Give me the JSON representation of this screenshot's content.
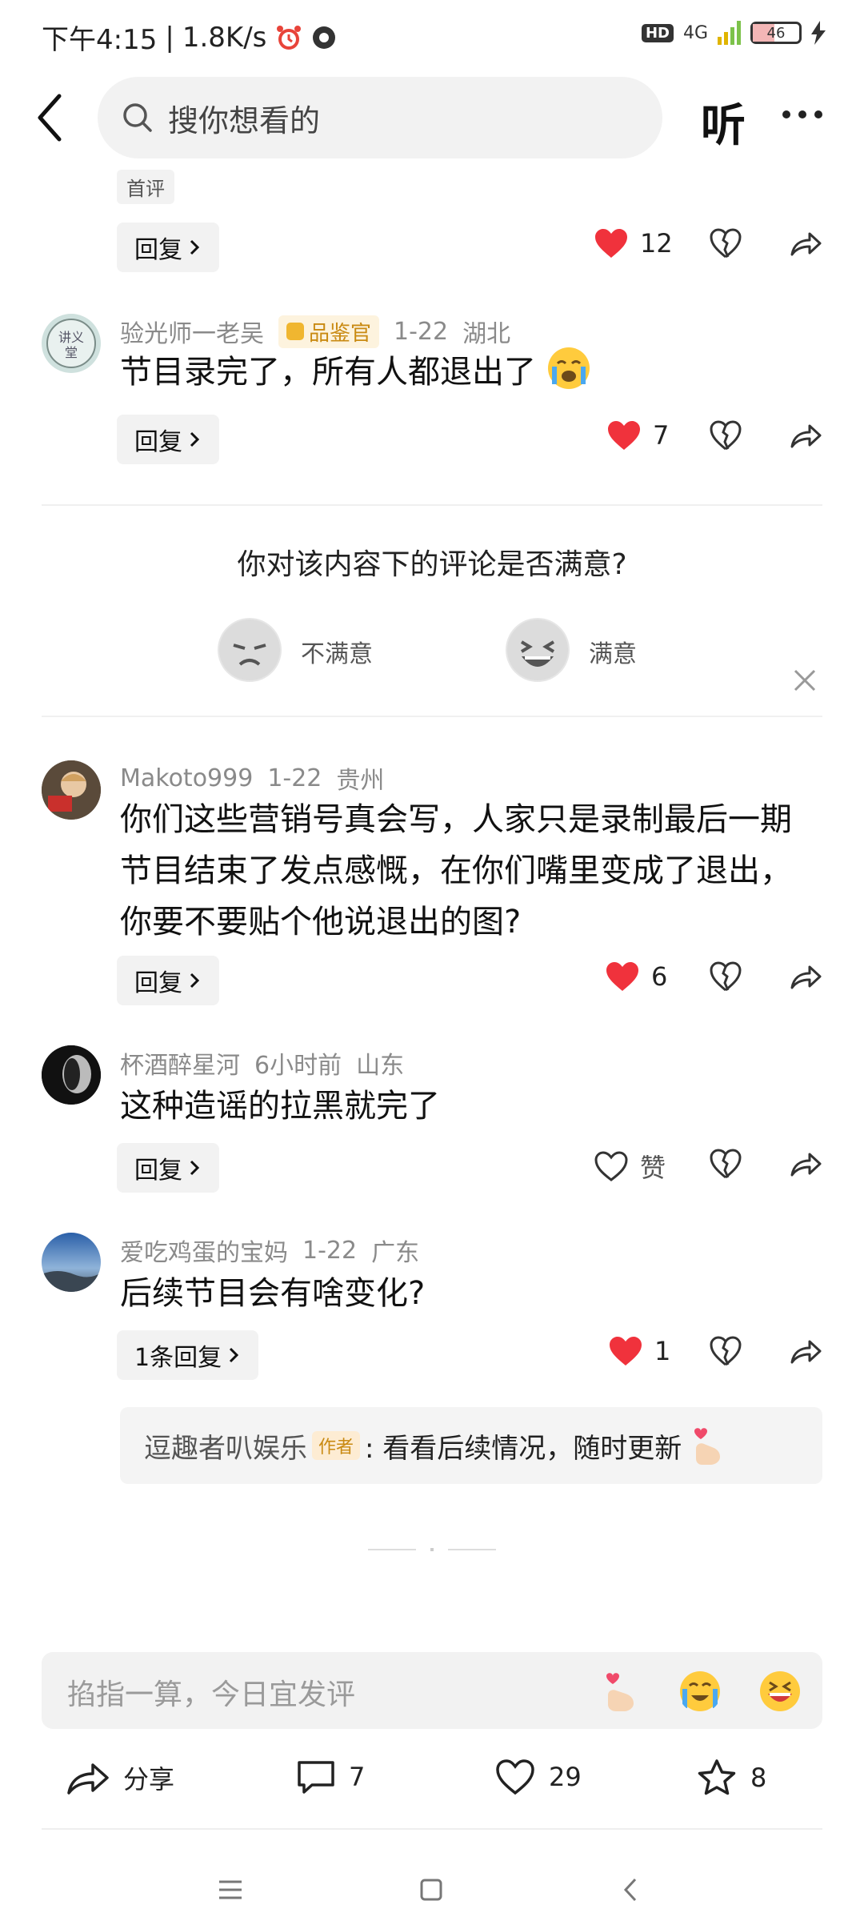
{
  "status": {
    "time": "下午4:15",
    "speed": "1.8K/s",
    "hd": "HD",
    "net": "4G",
    "battery": "46"
  },
  "header": {
    "search_placeholder": "搜你想看的",
    "listen": "听"
  },
  "comments": [
    {
      "tag": "首评",
      "reply_label": "回复",
      "likes": "12"
    },
    {
      "user": "验光师一老吴",
      "badge": "品鉴官",
      "date": "1-22",
      "location": "湖北",
      "text": "节目录完了，所有人都退出了",
      "reply_label": "回复",
      "likes": "7"
    },
    {
      "user": "Makoto999",
      "date": "1-22",
      "location": "贵州",
      "text": "你们这些营销号真会写，人家只是录制最后一期节目结束了发点感慨，在你们嘴里变成了退出，你要不要贴个他说退出的图?",
      "reply_label": "回复",
      "likes": "6"
    },
    {
      "user": "杯酒醉星河",
      "date": "6小时前",
      "location": "山东",
      "text": "这种造谣的拉黑就完了",
      "reply_label": "回复",
      "likes": "赞"
    },
    {
      "user": "爱吃鸡蛋的宝妈",
      "date": "1-22",
      "location": "广东",
      "text": "后续节目会有啥变化?",
      "reply_label": "1条回复",
      "likes": "1"
    }
  ],
  "survey": {
    "question": "你对该内容下的评论是否满意?",
    "option_bad": "不满意",
    "option_good": "满意"
  },
  "author_reply": {
    "name": "逗趣者叭娱乐",
    "tag": "作者",
    "text": ": 看看后续情况，随时更新"
  },
  "input": {
    "placeholder": "掐指一算，今日宜发评"
  },
  "bottom": {
    "share": "分享",
    "comments": "7",
    "likes": "29",
    "favorites": "8"
  }
}
